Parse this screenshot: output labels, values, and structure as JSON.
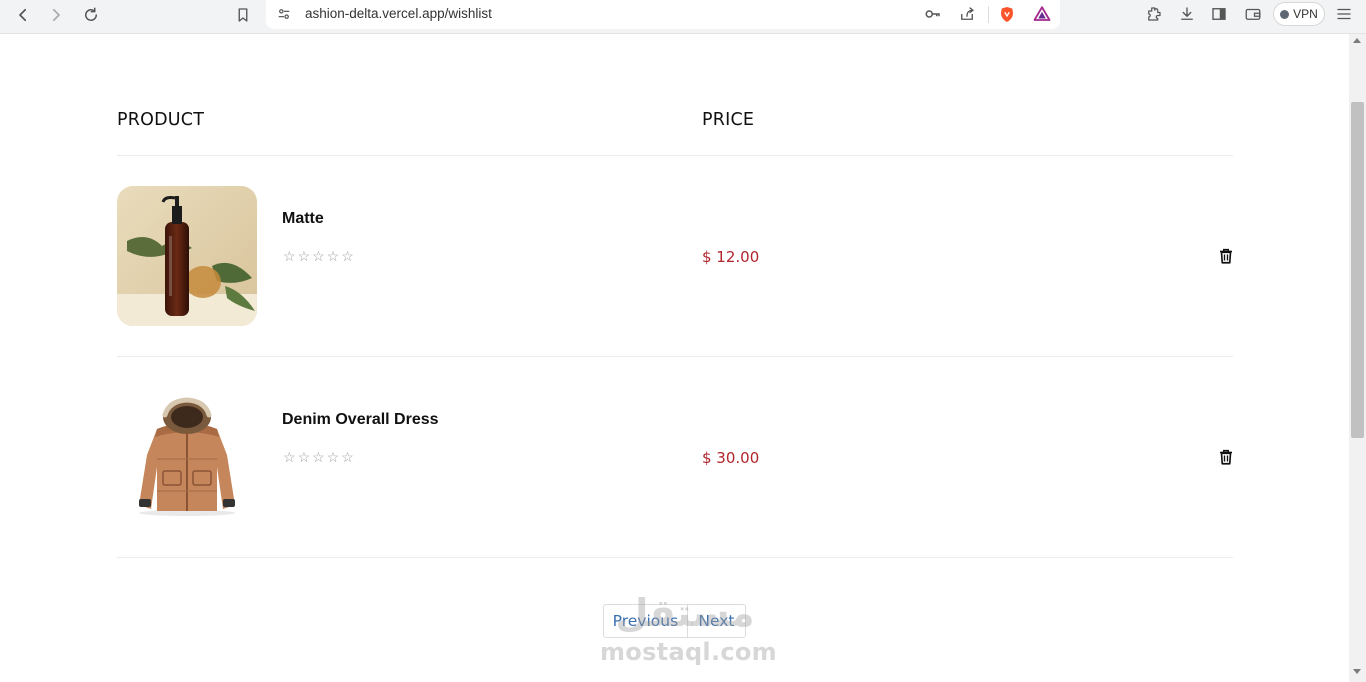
{
  "browser": {
    "url": "ashion-delta.vercel.app/wishlist",
    "vpn_label": "VPN"
  },
  "table": {
    "header_product": "PRODUCT",
    "header_price": "PRICE"
  },
  "items": [
    {
      "name": "Matte",
      "price": "$ 12.00",
      "rating": 0,
      "max_rating": 5,
      "image_icon": "serum-bottle-photo"
    },
    {
      "name": "Denim Overall Dress",
      "price": "$ 30.00",
      "rating": 0,
      "max_rating": 5,
      "image_icon": "fur-hood-jacket-photo"
    }
  ],
  "pagination": {
    "previous_label": "Previous",
    "next_label": "Next"
  },
  "watermark": {
    "arabic": "مستقل",
    "latin": "mostaql.com"
  },
  "colors": {
    "price": "#b0252d",
    "pager_link": "#3a6fb0"
  }
}
